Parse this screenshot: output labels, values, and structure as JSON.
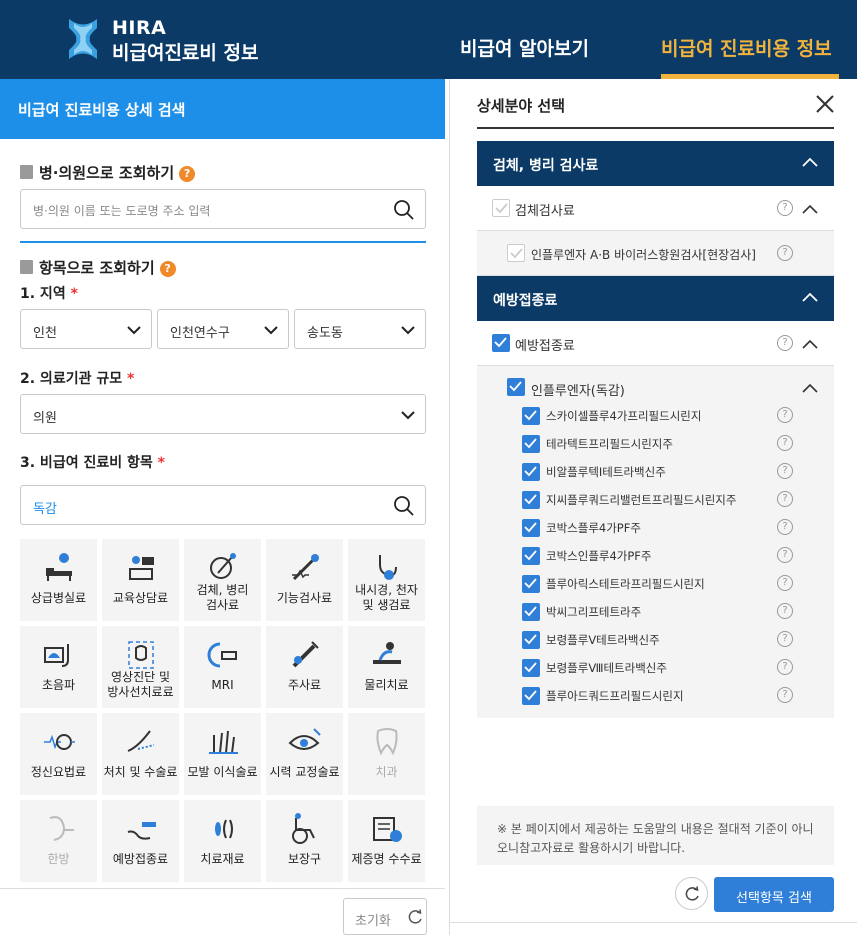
{
  "header": {
    "brand_line1": "HIRA",
    "brand_line2": "비급여진료비 정보",
    "nav": [
      "비급여 알아보기",
      "비급여 진료비용 정보"
    ],
    "active_nav": "비급여 진료비용 정보"
  },
  "left": {
    "panel_title": "비급여 진료비용 상세 검색",
    "hospital_section": {
      "title": "병·의원으로 조회하기",
      "search_placeholder": "병·의원 이름 또는 도로명 주소 입력"
    },
    "item_section": {
      "title": "항목으로 조회하기",
      "region_label": "1. 지역",
      "region_values": [
        "인천",
        "인천연수구",
        "송도동"
      ],
      "scale_label": "2. 의료기관 규모",
      "scale_value": "의원",
      "item_label": "3. 비급여 진료비 항목",
      "item_search_value": "독감",
      "required_mark": "*"
    },
    "categories": [
      {
        "label1": "상급병실료",
        "label2": "",
        "icon": "hospital-bed-icon",
        "enabled": true
      },
      {
        "label1": "교육상담료",
        "label2": "",
        "icon": "counseling-icon",
        "enabled": true
      },
      {
        "label1": "검체, 병리",
        "label2": "검사료",
        "icon": "pathology-icon",
        "enabled": true
      },
      {
        "label1": "기능검사료",
        "label2": "",
        "icon": "function-test-icon",
        "enabled": true
      },
      {
        "label1": "내시경, 천자",
        "label2": "및 생검료",
        "icon": "endoscope-icon",
        "enabled": true
      },
      {
        "label1": "초음파",
        "label2": "",
        "icon": "ultrasound-icon",
        "enabled": true
      },
      {
        "label1": "영상진단 및",
        "label2": "방사선치료료",
        "icon": "xray-icon",
        "enabled": true
      },
      {
        "label1": "MRI",
        "label2": "",
        "icon": "mri-icon",
        "enabled": true
      },
      {
        "label1": "주사료",
        "label2": "",
        "icon": "injection-icon",
        "enabled": true
      },
      {
        "label1": "물리치료",
        "label2": "",
        "icon": "physical-therapy-icon",
        "enabled": true
      },
      {
        "label1": "정신요법료",
        "label2": "",
        "icon": "psychotherapy-icon",
        "enabled": true
      },
      {
        "label1": "처치 및 수술료",
        "label2": "",
        "icon": "surgery-icon",
        "enabled": true
      },
      {
        "label1": "모발 이식술료",
        "label2": "",
        "icon": "hair-transplant-icon",
        "enabled": true
      },
      {
        "label1": "시력 교정술료",
        "label2": "",
        "icon": "eye-surgery-icon",
        "enabled": true
      },
      {
        "label1": "치과",
        "label2": "",
        "icon": "tooth-icon",
        "enabled": false
      },
      {
        "label1": "한방",
        "label2": "",
        "icon": "oriental-medicine-icon",
        "enabled": false
      },
      {
        "label1": "예방접종료",
        "label2": "",
        "icon": "vaccination-icon",
        "enabled": true
      },
      {
        "label1": "치료재료",
        "label2": "",
        "icon": "treatment-material-icon",
        "enabled": true
      },
      {
        "label1": "보장구",
        "label2": "",
        "icon": "wheelchair-icon",
        "enabled": true
      },
      {
        "label1": "제증명 수수료",
        "label2": "",
        "icon": "certificate-icon",
        "enabled": true
      }
    ],
    "reset_label": "초기화"
  },
  "right": {
    "title": "상세분야 선택",
    "groups": [
      {
        "name": "검체, 병리 검사료",
        "sub": "검체검사료",
        "sub_checked": false,
        "item": "인플루엔자 A·B 바이러스항원검사[현장검사]",
        "item_checked": false
      },
      {
        "name": "예방접종료",
        "sub": "예방접종료",
        "sub_checked": true,
        "item": "인플루엔자(독감)",
        "item_checked": true
      }
    ],
    "vaccines": [
      "스카이셀플루4가프리필드시린지",
      "테라텍트프리필드시린지주",
      "비알플루텍I테트라백신주",
      "지씨플루쿼드리밸런트프리필드시린지주",
      "코박스플루4가PF주",
      "코박스인플루4가PF주",
      "플루아릭스테트라프리필드시린지",
      "박씨그리프테트라주",
      "보령플루Ⅴ테트라백신주",
      "보령플루Ⅷ테트라백신주",
      "플루아드쿼드프리필드시린지"
    ],
    "help_mark": "?",
    "notice_line1": "※ 본 페이지에서 제공하는 도움말의 내용은 절대적 기준이 아니",
    "notice_line2": "오니참고자료로 활용하시기 바랍니다.",
    "search_button": "선택항목 검색"
  },
  "colors": {
    "navy": "#0b3a66",
    "blue": "#1e8fe8",
    "gold": "#f2b33d",
    "check": "#2f7fd8",
    "help_orange": "#f0892a"
  }
}
